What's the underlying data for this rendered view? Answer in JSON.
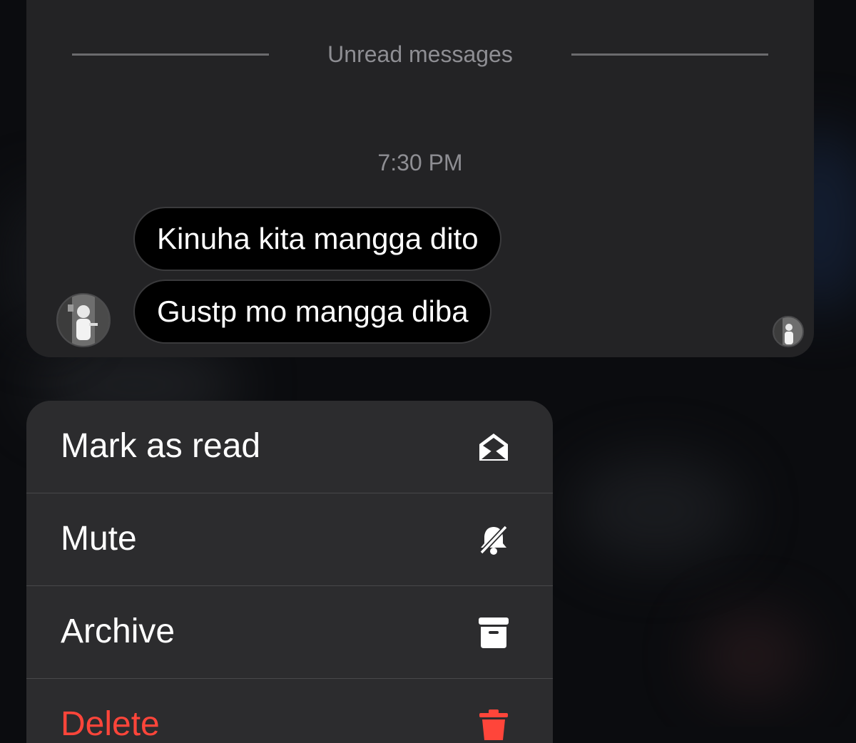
{
  "conversation": {
    "divider_label": "Unread messages",
    "timestamp": "7:30 PM",
    "messages": [
      {
        "text": "Kinuha kita mangga dito"
      },
      {
        "text": "Gustp mo mangga diba"
      }
    ]
  },
  "menu": {
    "items": [
      {
        "label": "Mark as read",
        "icon": "envelope-open-icon"
      },
      {
        "label": "Mute",
        "icon": "bell-slash-icon"
      },
      {
        "label": "Archive",
        "icon": "archive-box-icon"
      },
      {
        "label": "Delete",
        "icon": "trash-icon",
        "color": "#ff453a"
      }
    ]
  },
  "colors": {
    "card_background": "#232325",
    "menu_background": "#2c2c2e",
    "bubble_background": "#000000",
    "destructive": "#ff453a",
    "secondary_text": "#8e8e93"
  }
}
